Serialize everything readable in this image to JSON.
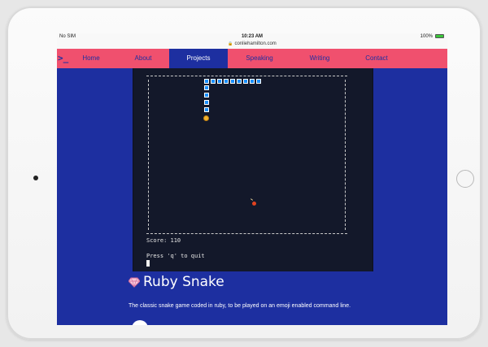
{
  "status_bar": {
    "carrier": "No SIM",
    "time": "10:23 AM",
    "battery": "100%"
  },
  "browser": {
    "url": "conliehamilton.com",
    "lock_icon": "lock-icon"
  },
  "nav": {
    "logo": ">_",
    "items": [
      {
        "label": "Home"
      },
      {
        "label": "About"
      },
      {
        "label": "Projects",
        "active": true
      },
      {
        "label": "Speaking"
      },
      {
        "label": "Writing"
      },
      {
        "label": "Contact"
      }
    ]
  },
  "terminal": {
    "score_label": "Score: 110",
    "quit_label": "Press 'q' to quit",
    "snake_color": "#1a8ffe",
    "head_icon": "emoji-face-icon",
    "food_icon": "apple-icon"
  },
  "project": {
    "title": "Ruby Snake",
    "title_icon": "gem-icon",
    "description": "The classic snake game coded in ruby, to be played on an emoji enabled command line."
  },
  "colors": {
    "nav_background": "#f0506e",
    "page_background": "#1d2fa0",
    "terminal_background": "#13182a"
  }
}
